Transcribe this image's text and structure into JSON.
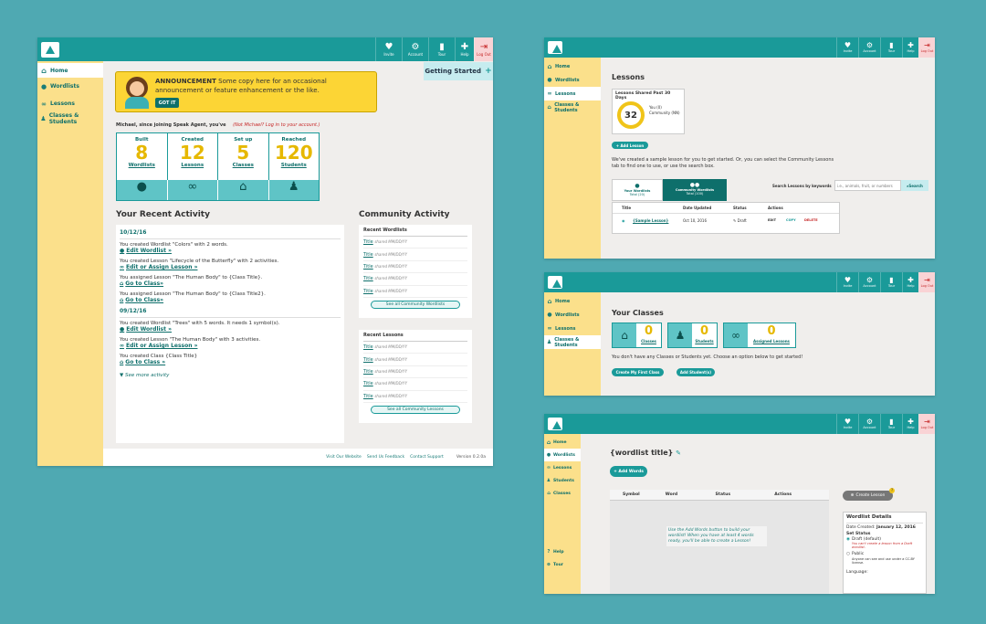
{
  "nav": {
    "invite": "Invite",
    "account": "Account",
    "tour": "Tour",
    "help": "Help",
    "logout": "Log Out"
  },
  "sidebar": {
    "home": "Home",
    "wordlists": "Wordlists",
    "lessons": "Lessons",
    "classes": "Classes & Students",
    "help": "Help",
    "tour": "Tour"
  },
  "home": {
    "announcement_title": "ANNOUNCEMENT",
    "announcement_text": "Some copy here for an occasional announcement or feature enhancement or the like.",
    "got_it": "GOT IT",
    "getting_started": "Getting Started",
    "greeting": "Michael, since joining Speak Agent, you've",
    "not_user": "(Not Michael? Log in to your account.)",
    "stats": [
      {
        "verb": "Built",
        "num": "8",
        "label": "Wordlists"
      },
      {
        "verb": "Created",
        "num": "12",
        "label": "Lessons"
      },
      {
        "verb": "Set up",
        "num": "5",
        "label": "Classes"
      },
      {
        "verb": "Reached",
        "num": "120",
        "label": "Students"
      }
    ],
    "recent_title": "Your Recent Activity",
    "date1": "10/12/16",
    "date2": "09/12/16",
    "acts": [
      {
        "text": "You created Wordlist \"Colors\" with 2 words.",
        "link": "Edit Wordlist »"
      },
      {
        "text": "You created Lesson \"Lifecycle of the Butterfly\" with 2 activities.",
        "link": "Edit or Assign Lesson »"
      },
      {
        "text": "You assigned Lesson \"The Human Body\" to {Class Title}.",
        "link": "Go to Class»"
      },
      {
        "text": "You assigned Lesson \"The Human Body\" to {Class Title2}.",
        "link": "Go to Class»"
      },
      {
        "text": "You created Wordlist \"Trees\" with 5 words. It needs 1 symbol(s).",
        "link": "Edit Wordlist »"
      },
      {
        "text": "You created Lesson \"The Human Body\" with 3 activities.",
        "link": "Edit or Assign Lesson »"
      },
      {
        "text": "You created Class {Class Title}",
        "link": "Go to Class »"
      }
    ],
    "see_more": "See more activity",
    "community_title": "Community Activity",
    "recent_wordlists": "Recent Wordlists",
    "recent_lessons": "Recent Lessons",
    "item_title": "Title",
    "item_shared": "shared MM/DD/YY",
    "see_all_wordlists": "See all Community Wordlists",
    "see_all_lessons": "See all Community Lessons",
    "footer": {
      "visit": "Visit Our Website",
      "feedback": "Send Us Feedback",
      "support": "Contact Support",
      "version": "Version 0.2.0a"
    }
  },
  "lessons": {
    "title": "Lessons",
    "shared_title": "Lessons Shared Past 30 Days",
    "shared_num": "32",
    "you": "You (0)",
    "community": "Community (NN)",
    "add": "+ Add Lesson",
    "intro": "We've created a sample lesson for you to get started. Or, you can select the Community Lessons tab to find one to use, or use the search box.",
    "tab_your": "Your Wordlists",
    "tab_your_sub": "Total (20)",
    "tab_comm": "Community Wordlists",
    "tab_comm_sub": "Total (100)",
    "search_label": "Search Lessons by keywords",
    "search_placeholder": "i.e., animals, fruit, or numbers",
    "search_btn": "Search",
    "cols": [
      "Title",
      "Date Updated",
      "Status",
      "Actions"
    ],
    "row": {
      "title": "{Sample Lesson}",
      "date": "Oct 10, 2016",
      "status": "Draft",
      "edit": "EDIT",
      "copy": "COPY",
      "delete": "DELETE"
    }
  },
  "classes": {
    "title": "Your Classes",
    "cards": [
      {
        "num": "0",
        "label": "Classes"
      },
      {
        "num": "0",
        "label": "Students"
      },
      {
        "num": "0",
        "label": "Assigned Lessons"
      }
    ],
    "empty": "You don't have any Classes or Students yet. Choose an option below to get started!",
    "btn1": "Create My First Class",
    "btn2": "Add Student(s)"
  },
  "wordlist": {
    "title": "{wordlist title}",
    "add": "+ Add Words",
    "cols": [
      "Symbol",
      "Word",
      "Status",
      "Actions"
    ],
    "empty": "Use the Add Words button to build your wordlist! When you have at least 4 words ready, you'll be able to create a Lesson!",
    "create": "Create Lesson",
    "details": "Wordlist Details",
    "created": "Date Created:",
    "created_val": "January 12, 2016",
    "set_status": "Set Status",
    "draft": "Draft (default)",
    "draft_note": "You can't create a lesson from a Draft wordlist.",
    "public": "Public",
    "public_note": "Anyone can see and use under a CC-BY license.",
    "language": "Language:"
  },
  "colors": {
    "teal": "#1a9a99",
    "yellow": "#fbe08b",
    "stat_num": "#e6b800"
  }
}
